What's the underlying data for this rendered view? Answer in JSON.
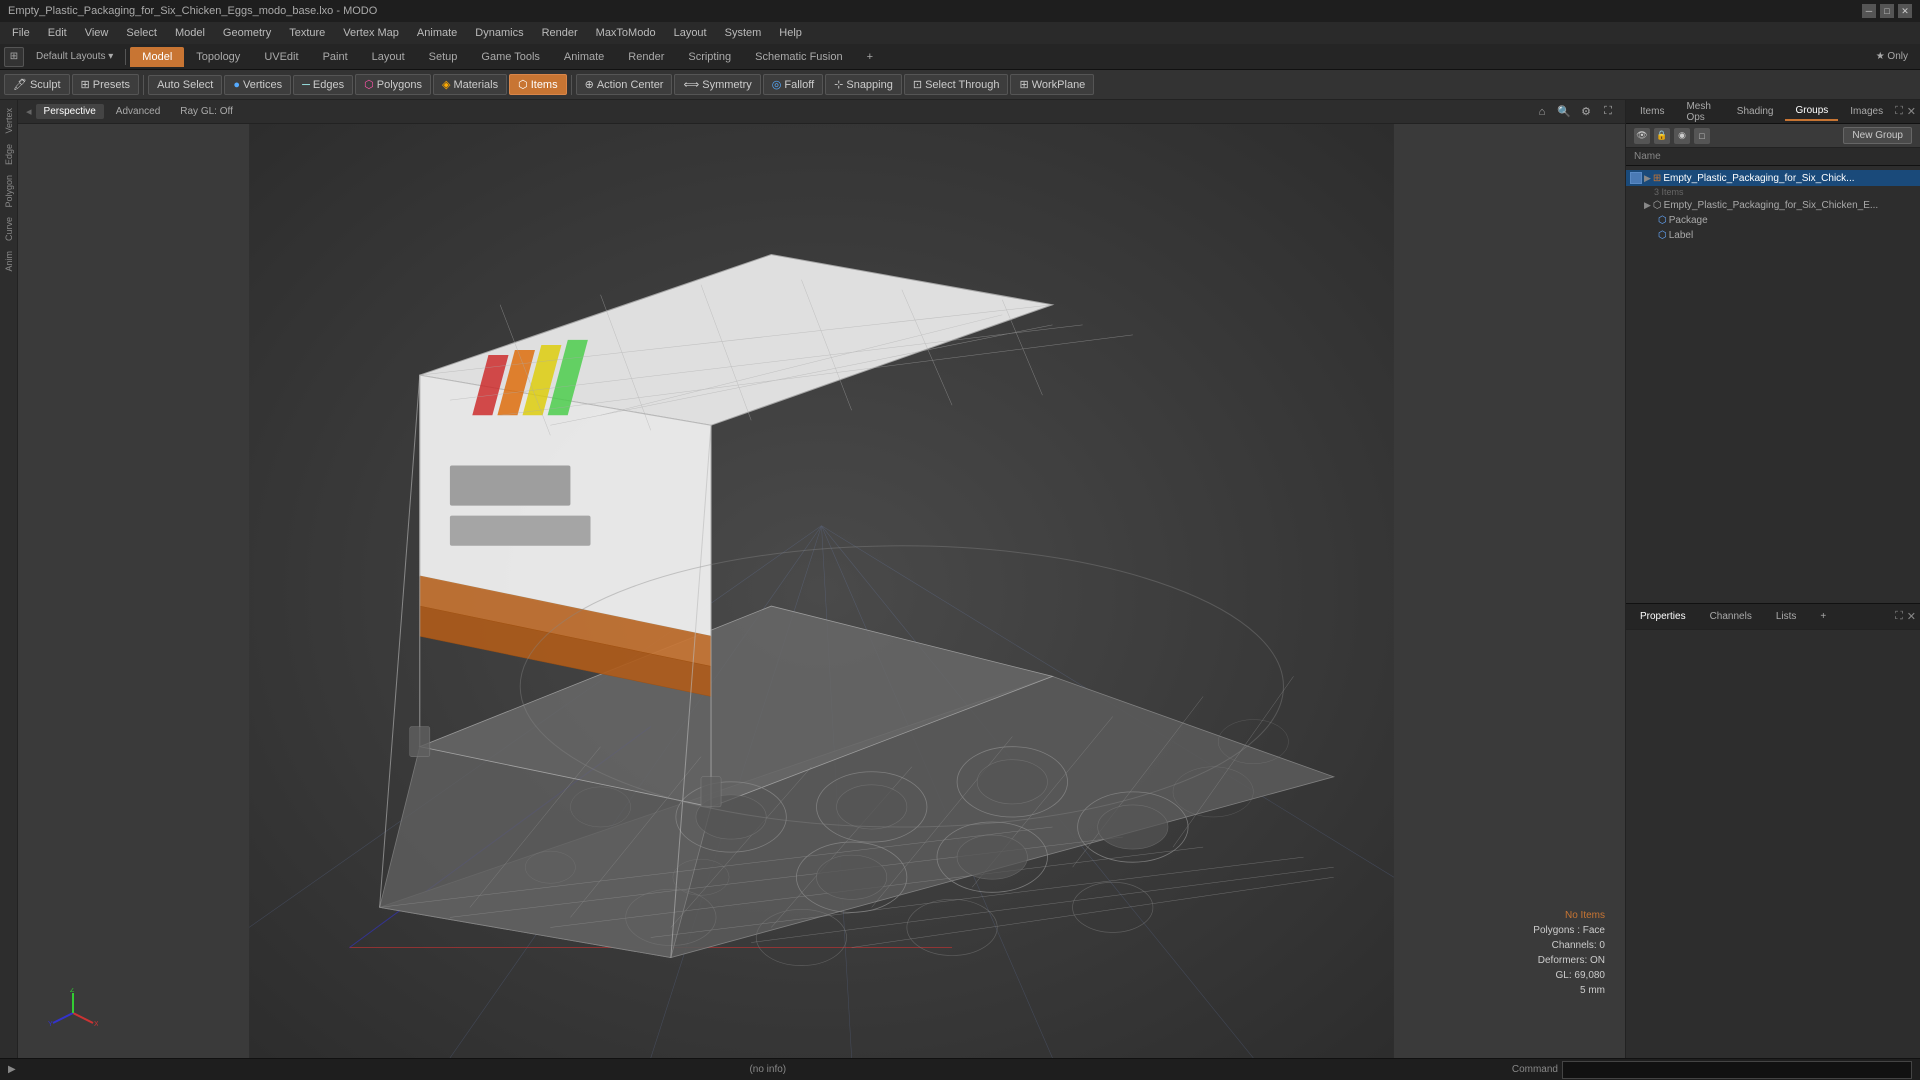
{
  "window": {
    "title": "Empty_Plastic_Packaging_for_Six_Chicken_Eggs_modo_base.lxo - MODO"
  },
  "menu": {
    "items": [
      "File",
      "Edit",
      "View",
      "Select",
      "Model",
      "Geometry",
      "Texture",
      "Vertex Map",
      "Animate",
      "Dynamics",
      "Render",
      "MaxToModo",
      "Layout",
      "System",
      "Help"
    ]
  },
  "tabs": {
    "items": [
      "Model",
      "Topology",
      "UVEdit",
      "Paint",
      "Layout",
      "Setup",
      "Game Tools",
      "Animate",
      "Render",
      "Scripting",
      "Schematic Fusion"
    ],
    "active": "Model",
    "plus_label": "+"
  },
  "toolbar": {
    "sculpt_label": "Sculpt",
    "presets_label": "Presets",
    "auto_select_label": "Auto Select",
    "vertices_label": "Vertices",
    "edges_label": "Edges",
    "polygons_label": "Polygons",
    "materials_label": "Materials",
    "items_label": "Items",
    "action_center_label": "Action Center",
    "symmetry_label": "Symmetry",
    "falloff_label": "Falloff",
    "snapping_label": "Snapping",
    "select_through_label": "Select Through",
    "workplane_label": "WorkPlane"
  },
  "viewport": {
    "perspective_label": "Perspective",
    "advanced_label": "Advanced",
    "ray_gl_label": "Ray GL: Off"
  },
  "status_overlay": {
    "no_items": "No Items",
    "polygons": "Polygons : Face",
    "channels": "Channels: 0",
    "deformers": "Deformers: ON",
    "gl": "GL: 69,080",
    "unit": "5 mm"
  },
  "status_bar": {
    "info": "(no info)",
    "command_label": "Command"
  },
  "right_panel": {
    "tabs": [
      "Items",
      "Mesh Ops",
      "Shading",
      "Groups",
      "Images"
    ],
    "active_tab": "Groups",
    "new_group_label": "New Group",
    "col_name": "Name",
    "tree": {
      "group_name": "Empty_Plastic_Packaging_for_Six_Chick...",
      "group_count": "3 Items",
      "items": [
        {
          "label": "Empty_Plastic_Packaging_for_Six_Chicken_E...",
          "indent": 1
        },
        {
          "label": "Package",
          "indent": 2
        },
        {
          "label": "Label",
          "indent": 2
        }
      ]
    }
  },
  "bottom_panel": {
    "tabs": [
      "Properties",
      "Channels",
      "Lists"
    ],
    "active_tab": "Properties",
    "plus": "+"
  },
  "left_sidebar": {
    "items": [
      "Vertex",
      "Edge",
      "Polygon",
      "Curve",
      "Anim"
    ]
  }
}
